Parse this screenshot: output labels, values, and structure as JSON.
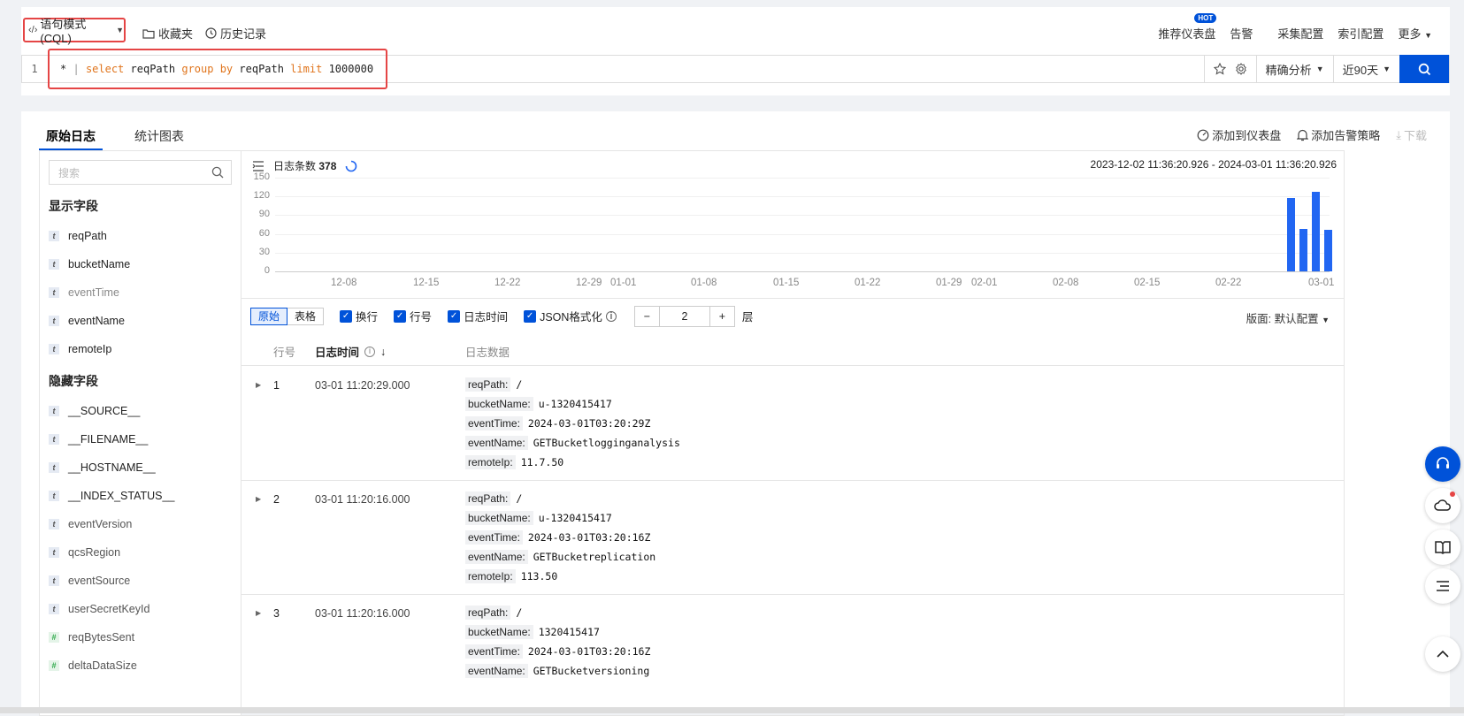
{
  "topbar": {
    "mode_label": "语句模式(CQL)",
    "favorites": "收藏夹",
    "history": "历史记录",
    "right_links": [
      "推荐仪表盘",
      "告警",
      "采集配置",
      "索引配置",
      "更多"
    ],
    "hot_badge": "HOT"
  },
  "query": {
    "line": "1",
    "parts": [
      "*",
      "|",
      "select",
      "reqPath",
      "group",
      "by",
      "reqPath",
      "limit",
      "1000000"
    ],
    "analysis": "精确分析",
    "time_range": "近90天"
  },
  "tabs": [
    "原始日志",
    "统计图表"
  ],
  "card_actions": [
    "添加到仪表盘",
    "添加告警策略",
    "下载"
  ],
  "sidebar": {
    "search_placeholder": "搜索",
    "shown_title": "显示字段",
    "shown_fields": [
      "reqPath",
      "bucketName",
      "eventTime",
      "eventName",
      "remoteIp"
    ],
    "hidden_title": "隐藏字段",
    "hidden_fields": [
      {
        "name": "__SOURCE__",
        "type": "t"
      },
      {
        "name": "__FILENAME__",
        "type": "t"
      },
      {
        "name": "__HOSTNAME__",
        "type": "t"
      },
      {
        "name": "__INDEX_STATUS__",
        "type": "t"
      },
      {
        "name": "eventVersion",
        "type": "t"
      },
      {
        "name": "qcsRegion",
        "type": "t"
      },
      {
        "name": "eventSource",
        "type": "t"
      },
      {
        "name": "userSecretKeyId",
        "type": "t"
      },
      {
        "name": "reqBytesSent",
        "type": "#"
      },
      {
        "name": "deltaDataSize",
        "type": "#"
      }
    ]
  },
  "histogram": {
    "count_label": "日志条数",
    "count": "378",
    "range": "2023-12-02 11:36:20.926 - 2024-03-01 11:36:20.926"
  },
  "chart_data": {
    "type": "bar",
    "yticks": [
      150,
      120,
      90,
      60,
      30,
      0
    ],
    "ylim": [
      0,
      150
    ],
    "xticks": [
      "12-08",
      "12-15",
      "12-22",
      "12-29",
      "01-01",
      "01-08",
      "01-15",
      "01-22",
      "01-29",
      "02-01",
      "02-08",
      "02-15",
      "02-22",
      "03-01"
    ],
    "values": [
      117,
      68,
      128,
      66
    ]
  },
  "toolbar": {
    "view_modes": [
      "原始",
      "表格"
    ],
    "options": [
      "换行",
      "行号",
      "日志时间",
      "JSON格式化"
    ],
    "level_value": "2",
    "level_unit": "层",
    "theme_label": "版面:",
    "theme_value": "默认配置"
  },
  "table": {
    "col_no": "行号",
    "col_time": "日志时间",
    "col_data": "日志数据",
    "rows": [
      {
        "no": "1",
        "time": "03-01 11:20:29.000",
        "fields": [
          [
            "reqPath:",
            "/"
          ],
          [
            "bucketName:",
            "u-1320415417"
          ],
          [
            "eventTime:",
            "2024-03-01T03:20:29Z"
          ],
          [
            "eventName:",
            "GETBucketlogginganalysis"
          ],
          [
            "remoteIp:",
            "11.7.50"
          ]
        ]
      },
      {
        "no": "2",
        "time": "03-01 11:20:16.000",
        "fields": [
          [
            "reqPath:",
            "/"
          ],
          [
            "bucketName:",
            "u-1320415417"
          ],
          [
            "eventTime:",
            "2024-03-01T03:20:16Z"
          ],
          [
            "eventName:",
            "GETBucketreplication"
          ],
          [
            "remoteIp:",
            "113.50"
          ]
        ]
      },
      {
        "no": "3",
        "time": "03-01 11:20:16.000",
        "fields": [
          [
            "reqPath:",
            "/"
          ],
          [
            "bucketName:",
            "1320415417"
          ],
          [
            "eventTime:",
            "2024-03-01T03:20:16Z"
          ],
          [
            "eventName:",
            "GETBucketversioning"
          ]
        ]
      }
    ]
  }
}
